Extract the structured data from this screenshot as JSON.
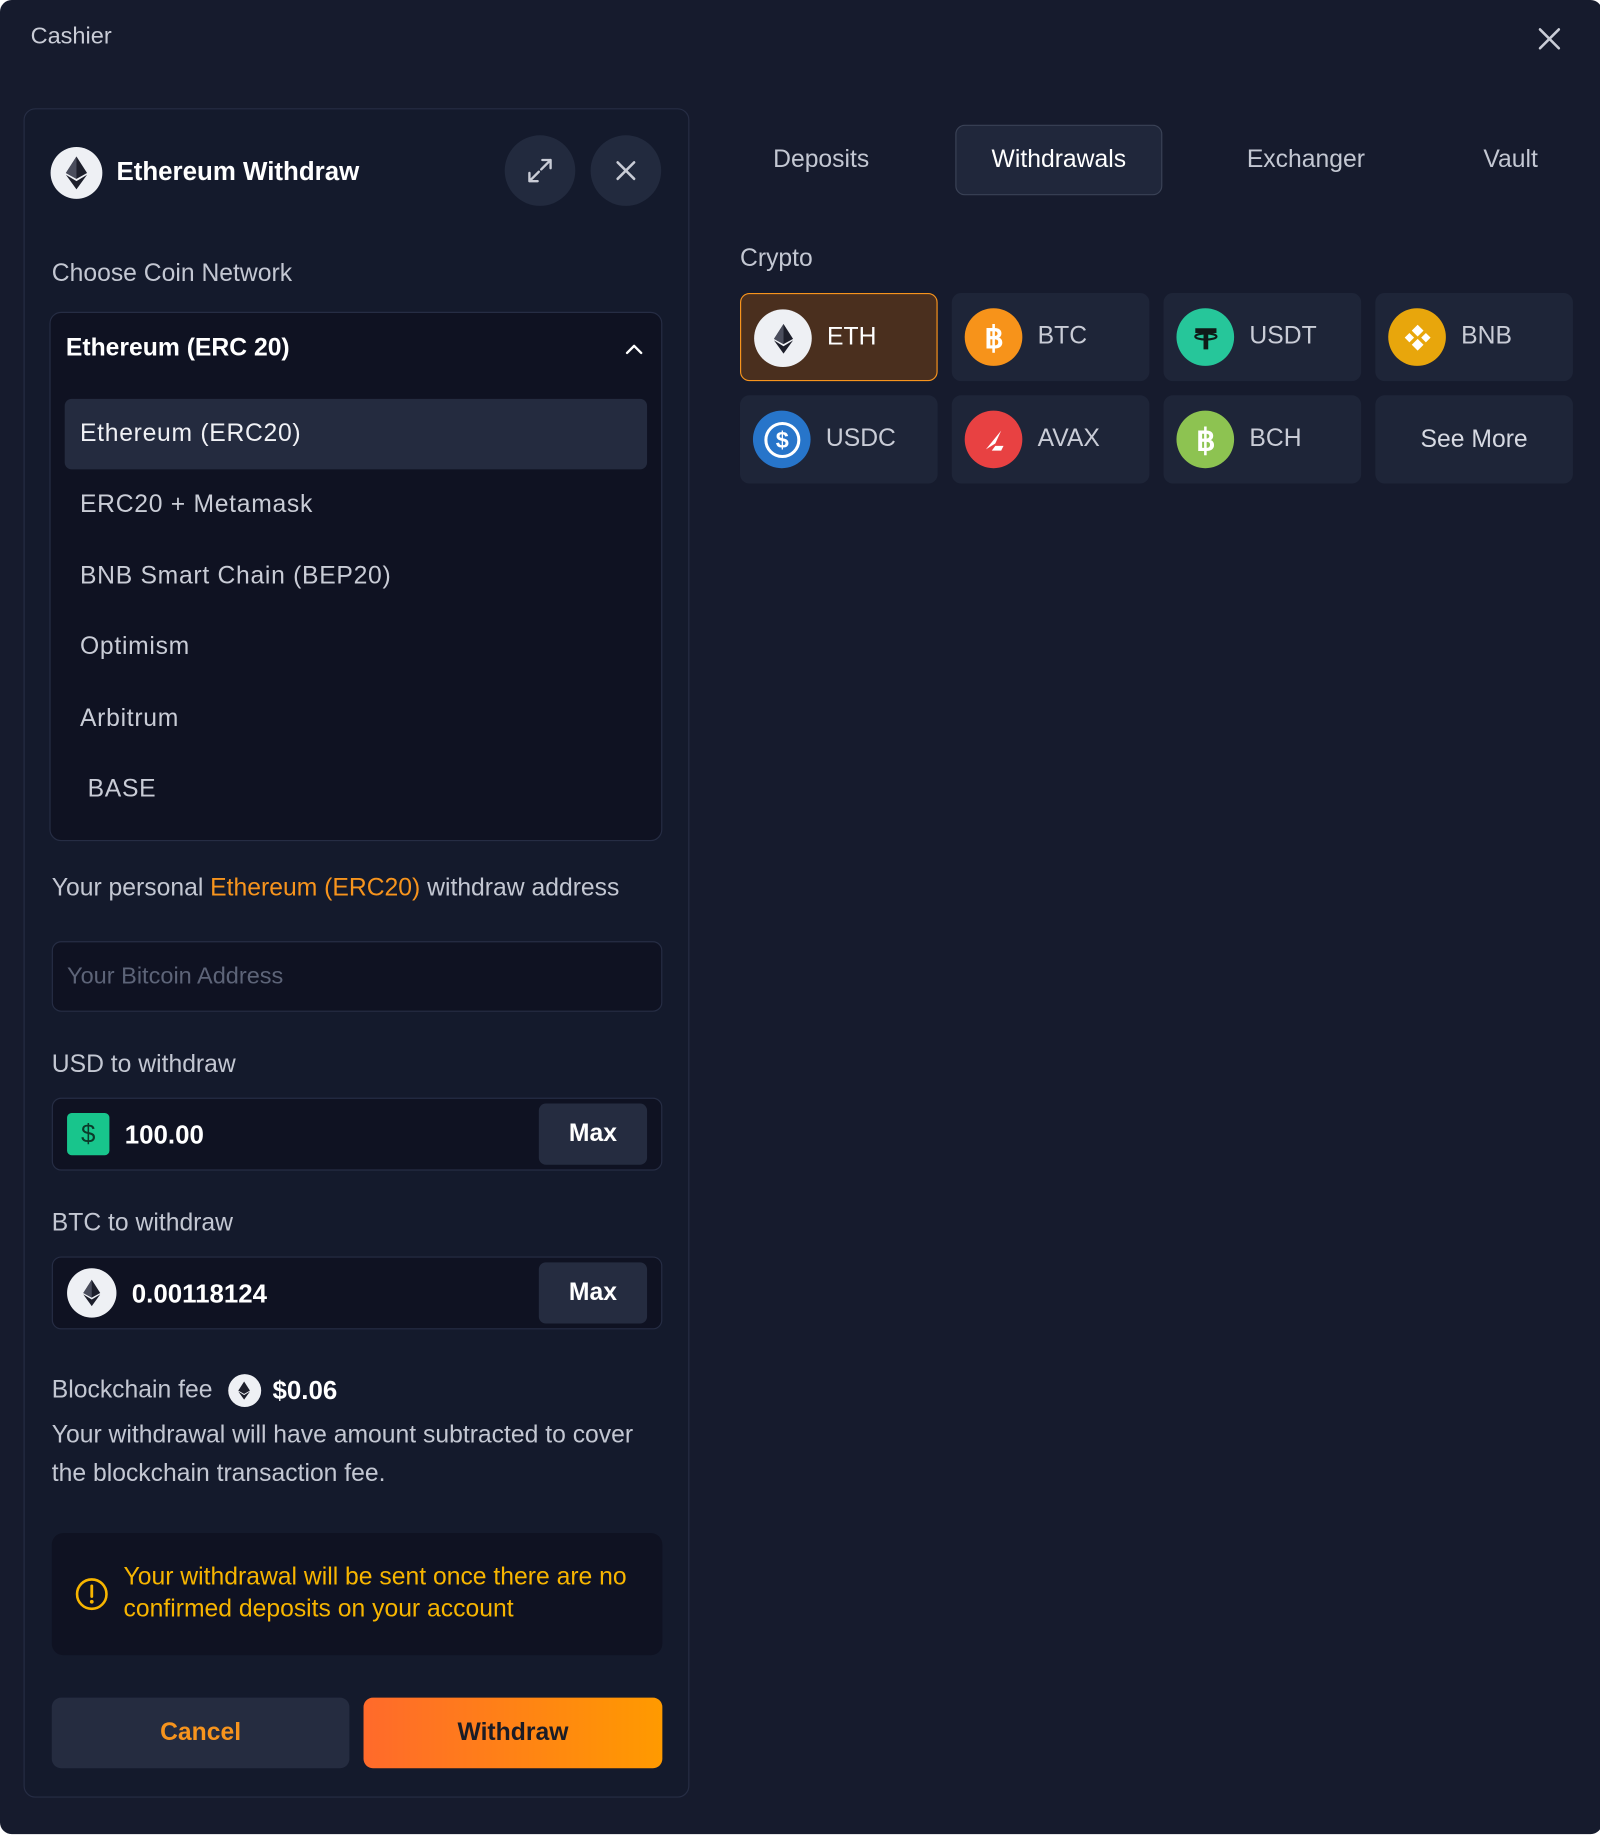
{
  "window": {
    "title": "Cashier"
  },
  "panel": {
    "title": "Ethereum Withdraw",
    "network_label": "Choose Coin Network",
    "network_selected": "Ethereum (ERC 20)",
    "network_options": [
      "Ethereum (ERC20)",
      "ERC20 + Metamask",
      "BNB Smart Chain  (BEP20)",
      "Optimism",
      "Arbitrum",
      " BASE"
    ],
    "address_label_prefix": "Your personal ",
    "address_label_highlight": "Ethereum (ERC20)",
    "address_label_suffix": " withdraw address",
    "address_placeholder": "Your Bitcoin Address",
    "usd_label": "USD to withdraw",
    "usd_symbol": "$",
    "usd_value": "100.00",
    "max_label": "Max",
    "coin_label": "BTC to withdraw",
    "coin_value": "0.00118124",
    "fee_label": "Blockchain fee",
    "fee_value": "$0.06",
    "fee_note": "Your withdrawal will have amount subtracted to cover the blockchain transaction fee.",
    "warning": "Your withdrawal will be sent once there are no confirmed deposits on your account",
    "cancel_label": "Cancel",
    "withdraw_label": "Withdraw"
  },
  "tabs": [
    "Deposits",
    "Withdrawals",
    "Exchanger",
    "Vault"
  ],
  "active_tab": "Withdrawals",
  "crypto_label": "Crypto",
  "coins": [
    "ETH",
    "BTC",
    "USDT",
    "BNB",
    "USDC",
    "AVAX",
    "BCH"
  ],
  "see_more_label": "See More",
  "colors": {
    "accent": "#f7941d",
    "background": "#161b2d",
    "warning": "#f7b500",
    "usd": "#18c58c"
  }
}
